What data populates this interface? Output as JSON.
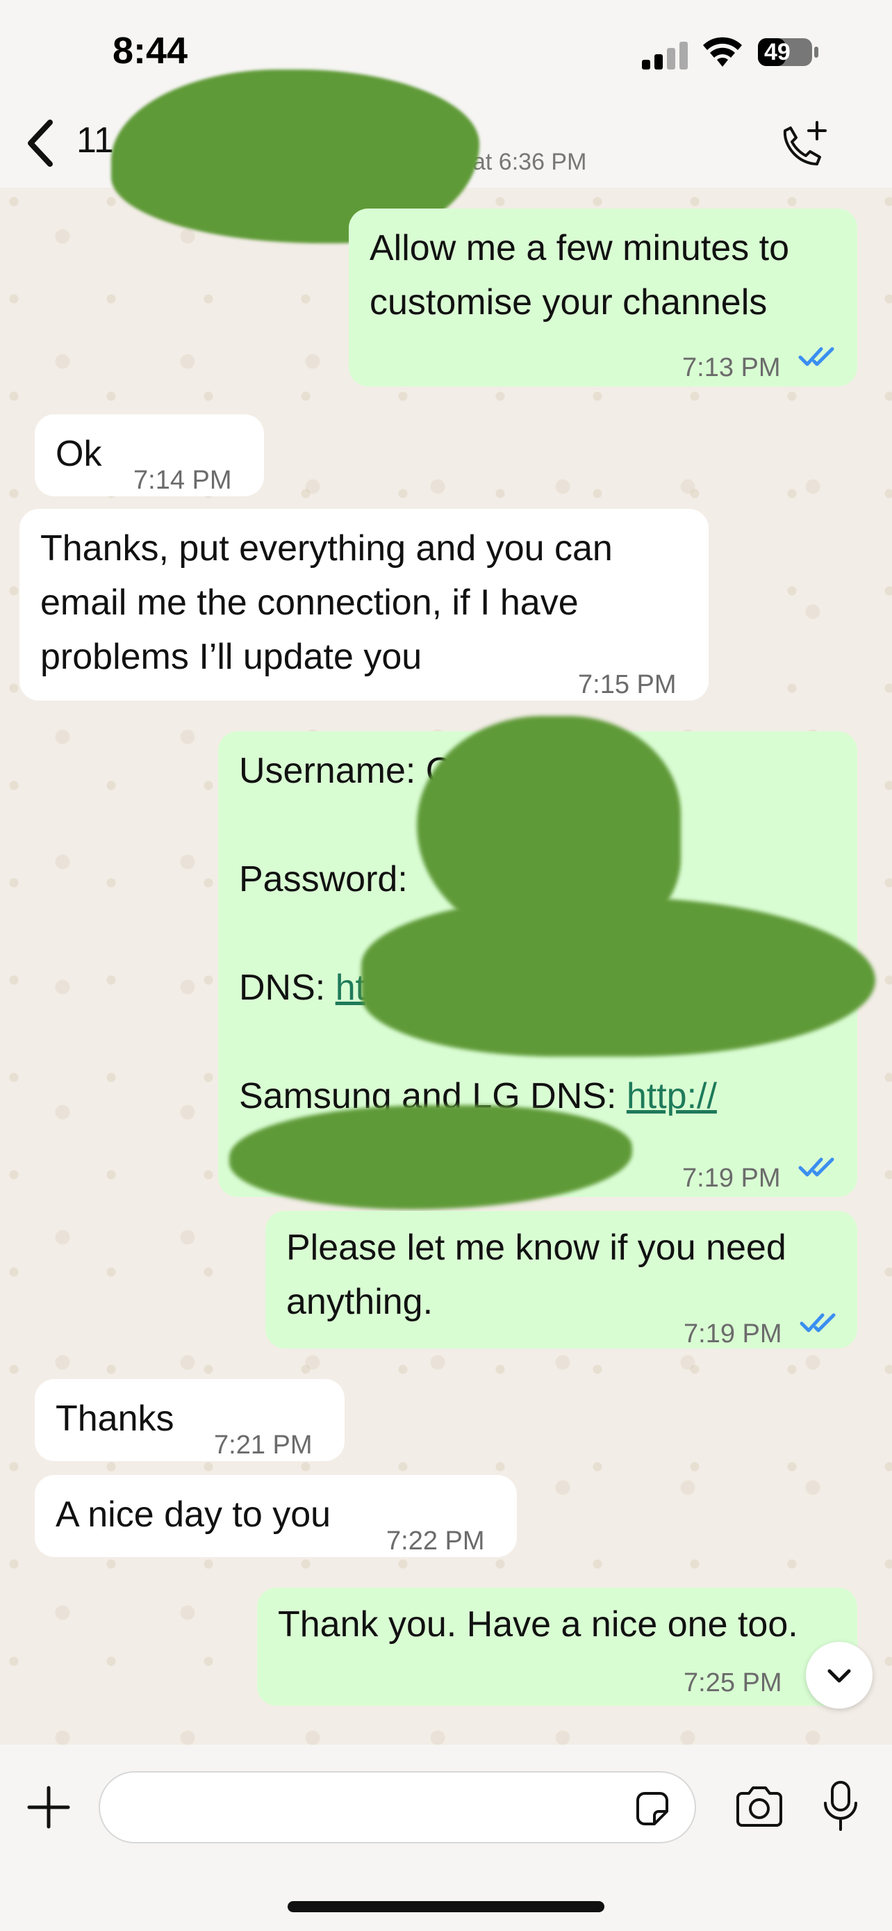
{
  "status_bar": {
    "time": "8:44",
    "battery": "49"
  },
  "header": {
    "contact": "11",
    "subtitle": "at 6:36 PM"
  },
  "messages": [
    {
      "dir": "out",
      "lines": [
        "Allow me a few minutes to",
        "customise your channels"
      ],
      "time": "7:13 PM"
    },
    {
      "dir": "in",
      "lines": [
        "Ok"
      ],
      "time": "7:14 PM"
    },
    {
      "dir": "in",
      "lines": [
        "Thanks, put everything and you can",
        "email me the connection, if I have",
        "problems I’ll update you"
      ],
      "time": "7:15 PM"
    },
    {
      "dir": "out",
      "username_label": "Username: C",
      "password_label": "Password:",
      "dns_label": "DNS: ",
      "dns_link": "ht",
      "samsung_label": "Samsung and LG DNS: ",
      "samsung_link": "http://",
      "time": "7:19 PM"
    },
    {
      "dir": "out",
      "lines": [
        "Please let me know if you need",
        "anything."
      ],
      "time": "7:19 PM"
    },
    {
      "dir": "in",
      "lines": [
        "Thanks"
      ],
      "time": "7:21 PM"
    },
    {
      "dir": "in",
      "lines": [
        "A nice day to you"
      ],
      "time": "7:22 PM"
    },
    {
      "dir": "out",
      "lines": [
        "Thank you. Have a nice one too."
      ],
      "time": "7:25 PM"
    }
  ],
  "composer": {
    "placeholder": ""
  },
  "colors": {
    "outgoing": "#d9fdd3",
    "incoming": "#ffffff",
    "read_ticks": "#3b8ef0",
    "redaction": "#5f9a38"
  },
  "icons": [
    "back-chevron-icon",
    "add-call-icon",
    "plus-icon",
    "sticker-icon",
    "camera-icon",
    "microphone-icon",
    "chevron-down-icon",
    "signal-icon",
    "wifi-icon",
    "battery-icon",
    "read-ticks-icon"
  ]
}
